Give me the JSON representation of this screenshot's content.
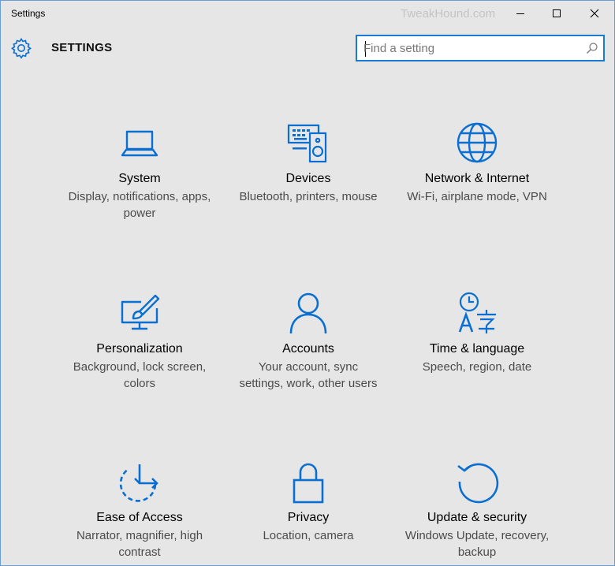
{
  "window": {
    "title": "Settings",
    "watermark": "TweakHound.com"
  },
  "header": {
    "heading": "SETTINGS",
    "icon": "gear-icon"
  },
  "search": {
    "placeholder": "Find a setting",
    "value": ""
  },
  "accent_color": "#0a6fd0",
  "tiles": [
    {
      "name": "System",
      "desc": "Display, notifications, apps, power",
      "icon": "laptop-icon"
    },
    {
      "name": "Devices",
      "desc": "Bluetooth, printers, mouse",
      "icon": "devices-icon"
    },
    {
      "name": "Network & Internet",
      "desc": "Wi-Fi, airplane mode, VPN",
      "icon": "globe-icon"
    },
    {
      "name": "Personalization",
      "desc": "Background, lock screen, colors",
      "icon": "paintbrush-monitor-icon"
    },
    {
      "name": "Accounts",
      "desc": "Your account, sync settings, work, other users",
      "icon": "person-icon"
    },
    {
      "name": "Time & language",
      "desc": "Speech, region, date",
      "icon": "time-language-icon"
    },
    {
      "name": "Ease of Access",
      "desc": "Narrator, magnifier, high contrast",
      "icon": "ease-of-access-icon"
    },
    {
      "name": "Privacy",
      "desc": "Location, camera",
      "icon": "padlock-icon"
    },
    {
      "name": "Update & security",
      "desc": "Windows Update, recovery, backup",
      "icon": "refresh-icon"
    }
  ]
}
